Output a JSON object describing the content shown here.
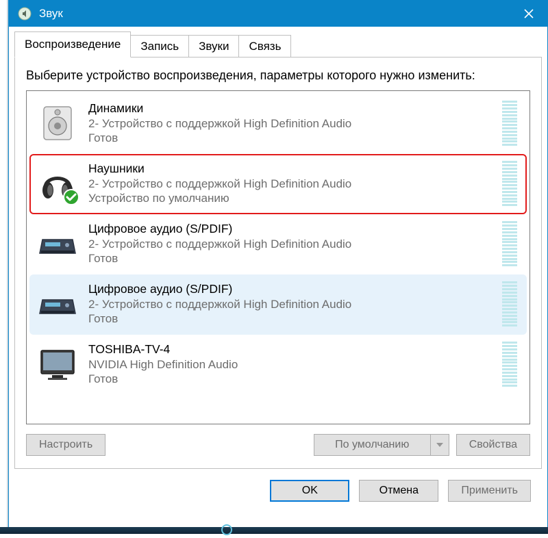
{
  "window": {
    "title": "Звук"
  },
  "tabs": {
    "playback": "Воспроизведение",
    "recording": "Запись",
    "sounds": "Звуки",
    "communications": "Связь"
  },
  "instruction": "Выберите устройство воспроизведения, параметры которого нужно изменить:",
  "devices": [
    {
      "name": "Динамики",
      "desc": "2- Устройство с поддержкой High Definition Audio",
      "status": "Готов",
      "icon": "speaker",
      "default": false,
      "highlight": false,
      "selected": false
    },
    {
      "name": "Наушники",
      "desc": "2- Устройство с поддержкой High Definition Audio",
      "status": "Устройство по умолчанию",
      "icon": "headphones",
      "default": true,
      "highlight": true,
      "selected": false
    },
    {
      "name": "Цифровое аудио (S/PDIF)",
      "desc": "2- Устройство с поддержкой High Definition Audio",
      "status": "Готов",
      "icon": "receiver",
      "default": false,
      "highlight": false,
      "selected": false
    },
    {
      "name": "Цифровое аудио (S/PDIF)",
      "desc": "2- Устройство с поддержкой High Definition Audio",
      "status": "Готов",
      "icon": "receiver",
      "default": false,
      "highlight": false,
      "selected": true
    },
    {
      "name": "TOSHIBA-TV-4",
      "desc": "NVIDIA High Definition Audio",
      "status": "Готов",
      "icon": "tv",
      "default": false,
      "highlight": false,
      "selected": false
    }
  ],
  "buttons": {
    "configure": "Настроить",
    "set_default": "По умолчанию",
    "properties": "Свойства",
    "ok": "OK",
    "cancel": "Отмена",
    "apply": "Применить"
  }
}
